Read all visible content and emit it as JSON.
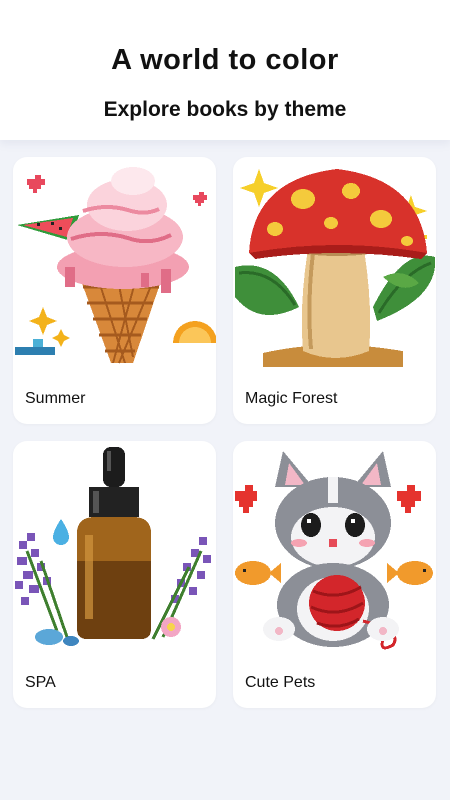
{
  "header": {
    "title": "A world to color",
    "subtitle": "Explore books by theme"
  },
  "books": [
    {
      "label": "Summer",
      "icon": "ice-cream-cone-icon"
    },
    {
      "label": "Magic Forest",
      "icon": "mushroom-icon"
    },
    {
      "label": "SPA",
      "icon": "essential-oil-bottle-icon"
    },
    {
      "label": "Cute Pets",
      "icon": "kitten-with-yarn-icon"
    }
  ]
}
